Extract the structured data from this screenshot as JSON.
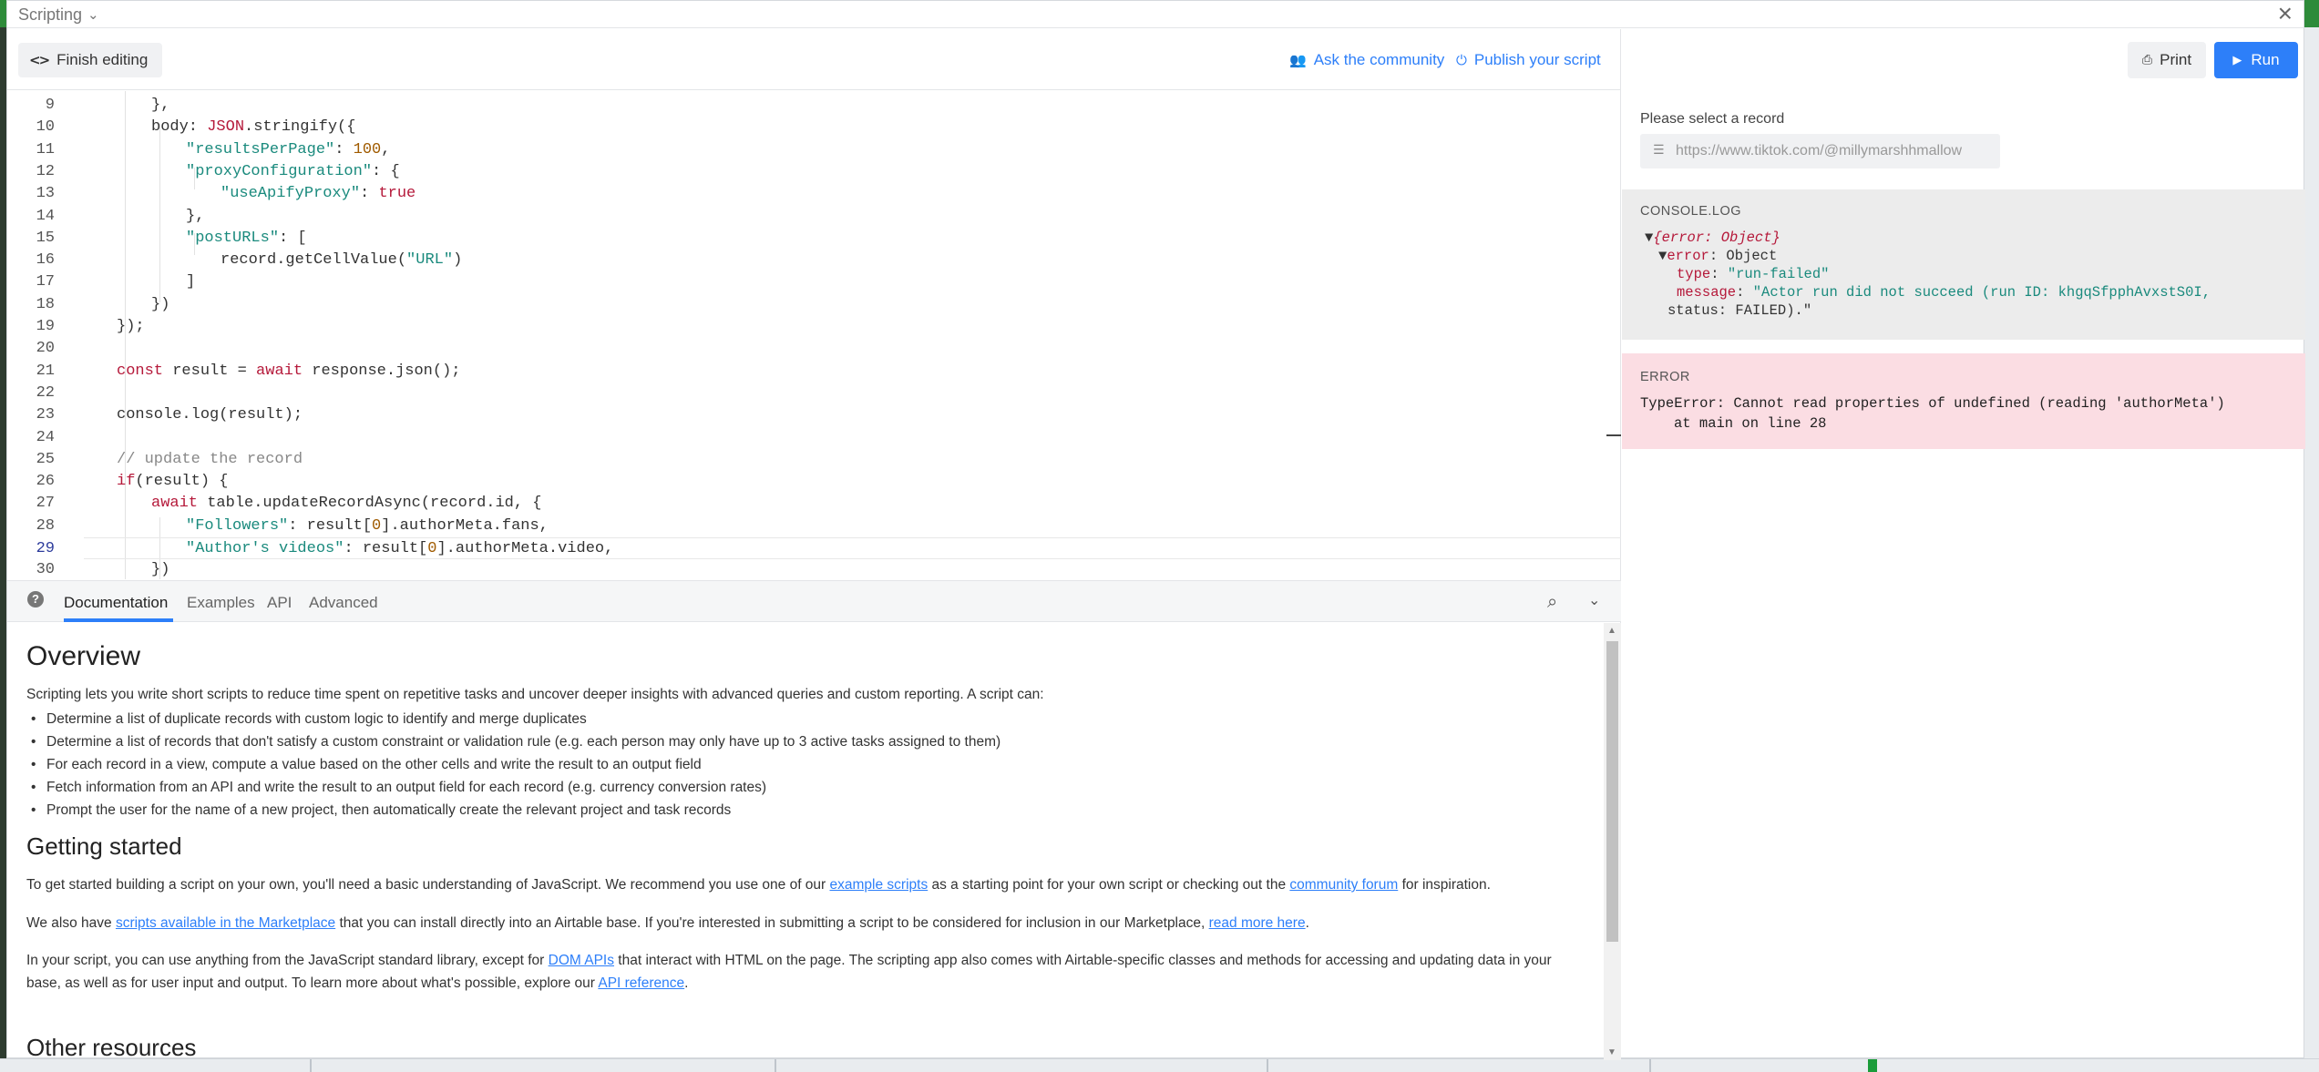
{
  "window": {
    "title": "Scripting"
  },
  "toolbar": {
    "finish_label": "Finish editing",
    "community_label": "Ask the community",
    "publish_label": "Publish your script"
  },
  "code_lines": [
    {
      "n": "9",
      "t": "},"
    },
    {
      "n": "10",
      "t": "body: JSON.stringify({"
    },
    {
      "n": "11",
      "t": "\"resultsPerPage\": 100,"
    },
    {
      "n": "12",
      "t": "\"proxyConfiguration\": {"
    },
    {
      "n": "13",
      "t": "\"useApifyProxy\": true"
    },
    {
      "n": "14",
      "t": "},"
    },
    {
      "n": "15",
      "t": "\"postURLs\": ["
    },
    {
      "n": "16",
      "t": "record.getCellValue(\"URL\")"
    },
    {
      "n": "17",
      "t": "]"
    },
    {
      "n": "18",
      "t": "})"
    },
    {
      "n": "19",
      "t": "});"
    },
    {
      "n": "20",
      "t": ""
    },
    {
      "n": "21",
      "t": "const result = await response.json();"
    },
    {
      "n": "22",
      "t": ""
    },
    {
      "n": "23",
      "t": "console.log(result);"
    },
    {
      "n": "24",
      "t": ""
    },
    {
      "n": "25",
      "t": "// update the record"
    },
    {
      "n": "26",
      "t": "if(result) {"
    },
    {
      "n": "27",
      "t": "await table.updateRecordAsync(record.id, {"
    },
    {
      "n": "28",
      "t": "\"Followers\": result[0].authorMeta.fans,"
    },
    {
      "n": "29",
      "t": "\"Author's videos\": result[0].authorMeta.video,"
    },
    {
      "n": "30",
      "t": "})"
    }
  ],
  "docs": {
    "tabs": [
      "Documentation",
      "Examples",
      "API",
      "Advanced"
    ],
    "overview_title": "Overview",
    "overview_text": "Scripting lets you write short scripts to reduce time spent on repetitive tasks and uncover deeper insights with advanced queries and custom reporting. A script can:",
    "bullets": [
      "Determine a list of duplicate records with custom logic to identify and merge duplicates",
      "Determine a list of records that don't satisfy a custom constraint or validation rule (e.g. each person may only have up to 3 active tasks assigned to them)",
      "For each record in a view, compute a value based on the other cells and write the result to an output field",
      "Fetch information from an API and write the result to an output field for each record (e.g. currency conversion rates)",
      "Prompt the user for the name of a new project, then automatically create the relevant project and task records"
    ],
    "getting_started_title": "Getting started",
    "gs_p1_a": "To get started building a script on your own, you'll need a basic understanding of JavaScript. We recommend you use one of our ",
    "gs_p1_link1": "example scripts",
    "gs_p1_b": " as a starting point for your own script or checking out the ",
    "gs_p1_link2": "community forum",
    "gs_p1_c": " for inspiration.",
    "gs_p2_a": "We also have ",
    "gs_p2_link1": "scripts available in the Marketplace",
    "gs_p2_b": " that you can install directly into an Airtable base. If you're interested in submitting a script to be considered for inclusion in our Marketplace, ",
    "gs_p2_link2": "read more here",
    "gs_p2_c": ".",
    "gs_p3_a": "In your script, you can use anything from the JavaScript standard library, except for ",
    "gs_p3_link1": "DOM APIs",
    "gs_p3_b": " that interact with HTML on the page. The scripting app also comes with Airtable-specific classes and methods for accessing and updating data in your base, as well as for user input and output. To learn more about what's possible, explore our ",
    "gs_p3_link2": "API reference",
    "gs_p3_c": ".",
    "other_title": "Other resources"
  },
  "run_panel": {
    "print_label": "Print",
    "run_label": "Run",
    "record_label": "Please select a record",
    "record_value": "https://www.tiktok.com/@millymarshhmallow",
    "console_header": "CONSOLE.LOG",
    "console_line1": "{error: Object}",
    "console_line2_key": "error",
    "console_line2_val": ": Object",
    "console_line3_key": "type",
    "console_line3_val": "\"run-failed\"",
    "console_line4_key": "message",
    "console_line4_val": "\"Actor run did not succeed (run ID: khgqSfpphAvxstS0I,",
    "console_line5": "status: FAILED).\"",
    "error_header": "ERROR",
    "error_message": "TypeError: Cannot read properties of undefined (reading 'authorMeta')",
    "error_location": "at main on line 28"
  },
  "colors": {
    "accent": "#2d7ff9",
    "error_bg": "#fbdde3",
    "console_bg": "#ececec",
    "keyword": "#b5193a",
    "string": "#1a8a7d"
  }
}
